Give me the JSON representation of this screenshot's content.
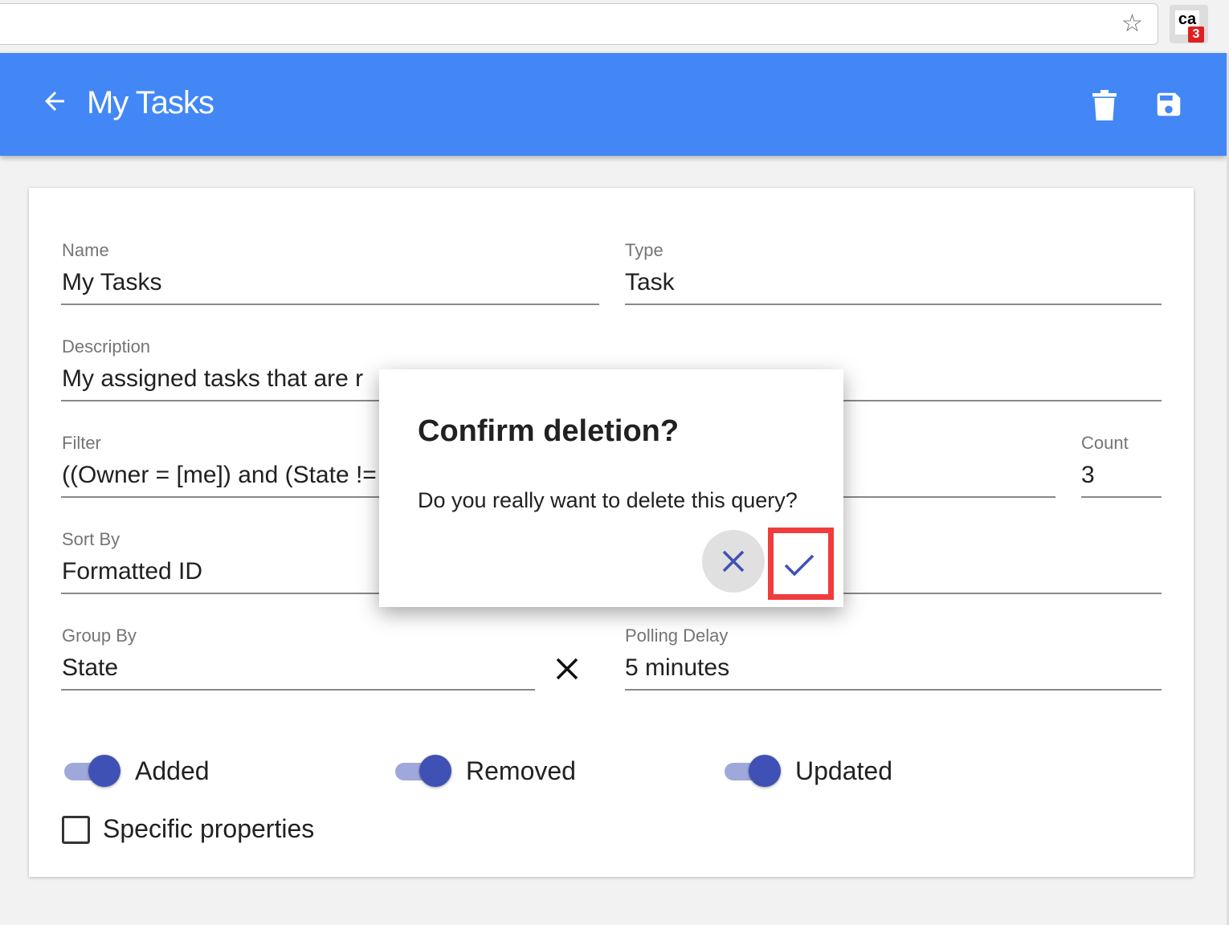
{
  "browser": {
    "star_icon": "star-icon",
    "extension_badge": "3",
    "extension_logo": "ca"
  },
  "appbar": {
    "title": "My Tasks",
    "back_icon": "arrow-left-icon",
    "delete_icon": "trash-icon",
    "save_icon": "floppy-disk-icon",
    "color": "#4287f5"
  },
  "form": {
    "name": {
      "label": "Name",
      "value": "My Tasks"
    },
    "type": {
      "label": "Type",
      "value": "Task"
    },
    "description": {
      "label": "Description",
      "value": "My assigned tasks that are r"
    },
    "filter": {
      "label": "Filter",
      "value": "((Owner = [me]) and (State !="
    },
    "count": {
      "label": "Count",
      "value": "3"
    },
    "sort_by": {
      "label": "Sort By",
      "value": "Formatted ID"
    },
    "group_by": {
      "label": "Group By",
      "value": "State"
    },
    "polling_delay": {
      "label": "Polling Delay",
      "value": "5 minutes"
    },
    "toggles": [
      {
        "label": "Added",
        "on": true
      },
      {
        "label": "Removed",
        "on": true
      },
      {
        "label": "Updated",
        "on": true
      }
    ],
    "specific_properties": {
      "label": "Specific properties",
      "checked": false
    }
  },
  "dialog": {
    "title": "Confirm deletion?",
    "message": "Do you really want to delete this query?",
    "cancel_icon": "close-icon",
    "confirm_icon": "check-icon",
    "accent": "#3f51b5",
    "highlight": "#f03c3c"
  }
}
